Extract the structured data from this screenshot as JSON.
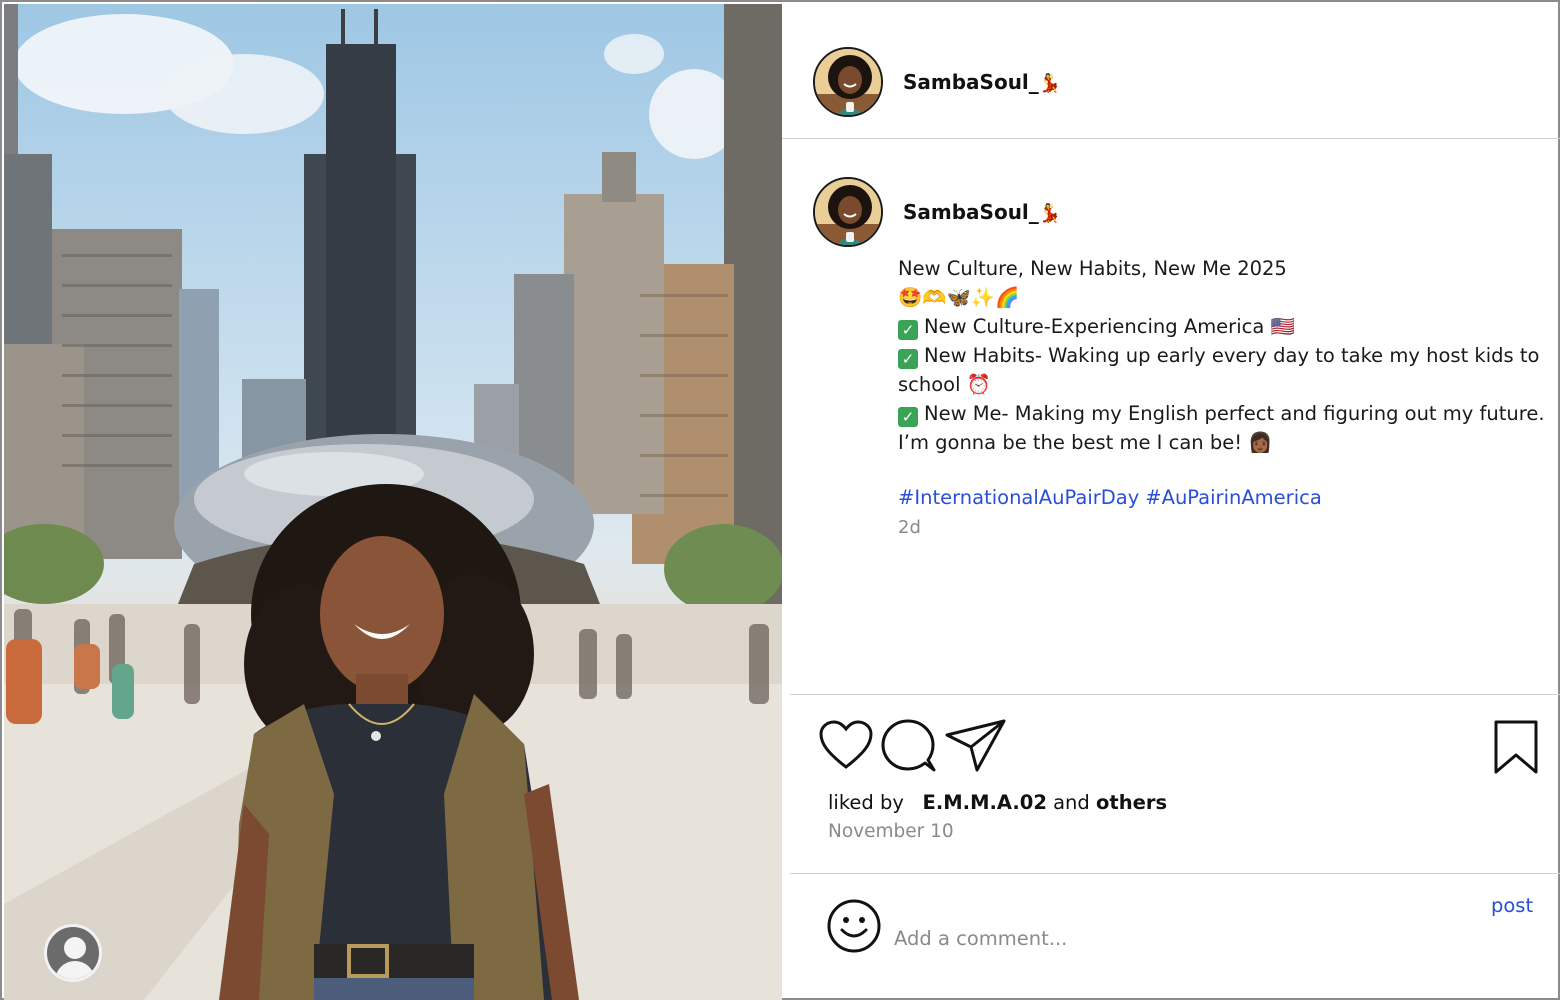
{
  "post": {
    "username": "SambaSoul_",
    "username_emoji": "💃",
    "caption": {
      "title": "New Culture, New Habits, New Me 2025",
      "emoji_line": "🤩🫶🦋✨🌈",
      "items": [
        {
          "text": "New Culture-Experiencing America",
          "emoji": "🇺🇸"
        },
        {
          "text": "New Habits- Waking up early every day to take my host kids to school",
          "emoji": "⏰"
        },
        {
          "text": "New Me- Making my English perfect and figuring out my future.  I’m gonna be the best me I can be!",
          "emoji": "👩🏾"
        }
      ],
      "hashtags": [
        "#InternationalAuPairDay",
        "#AuPairinAmerica"
      ],
      "time_ago": "2d"
    },
    "likes": {
      "prefix": "liked by",
      "user": "E.M.M.A.02",
      "conjunction": "and",
      "others": "others"
    },
    "date": "November 10"
  },
  "comment": {
    "placeholder": "Add a comment...",
    "post_label": "post"
  },
  "icons": {
    "like": "heart-icon",
    "comment": "comment-bubble-icon",
    "share": "paper-plane-icon",
    "save": "bookmark-icon",
    "emoji": "smiley-icon",
    "tag": "user-tag-icon"
  },
  "colors": {
    "hashtag": "#2a4fd6",
    "muted": "#8a8a8a",
    "divider": "#d0d0d0",
    "check": "#3aa357"
  }
}
